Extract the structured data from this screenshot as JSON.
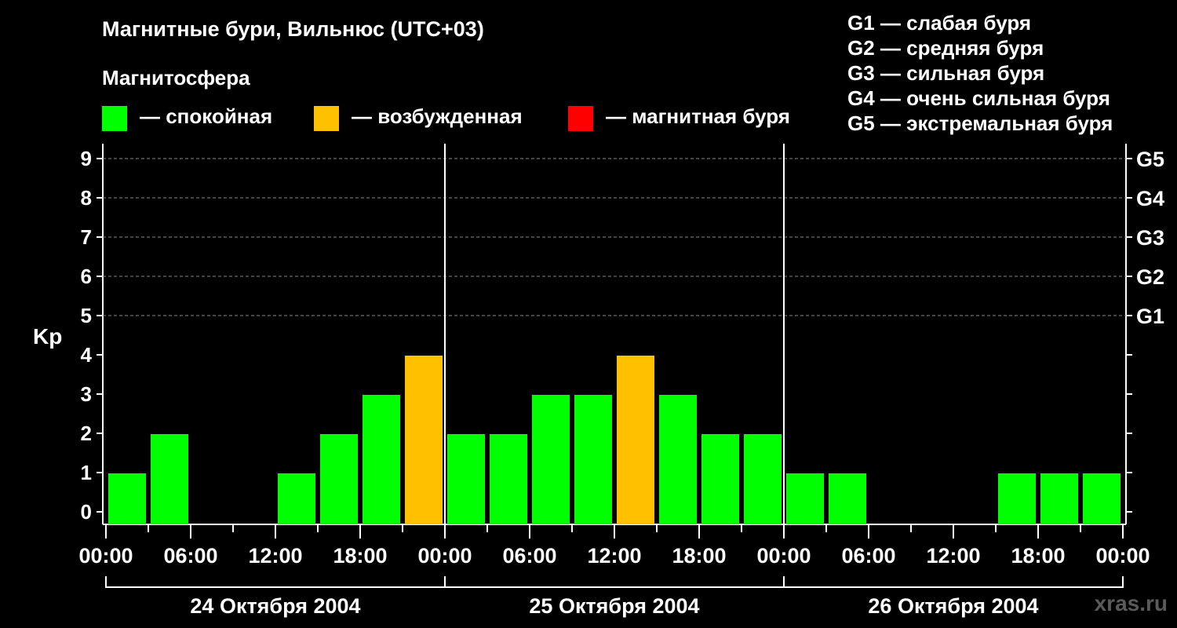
{
  "title": "Магнитные бури, Вильнюс (UTC+03)",
  "magnetosphere_label": "Магнитосфера",
  "legend": [
    {
      "color": "#00ff00",
      "label": "— спокойная"
    },
    {
      "color": "#ffc000",
      "label": "— возбужденная"
    },
    {
      "color": "#ff0000",
      "label": "— магнитная буря"
    }
  ],
  "storm_scale": [
    "G1 — слабая буря",
    "G2 — средняя буря",
    "G3 — сильная буря",
    "G4 — очень сильная буря",
    "G5 — экстремальная буря"
  ],
  "watermark": "xras.ru",
  "chart_data": {
    "type": "bar",
    "ylabel": "Kp",
    "ylim": [
      0,
      9
    ],
    "y_ticks": [
      "0",
      "1",
      "2",
      "3",
      "4",
      "5",
      "6",
      "7",
      "8",
      "9"
    ],
    "right_ticks": [
      {
        "kp": 5,
        "label": "G1"
      },
      {
        "kp": 6,
        "label": "G2"
      },
      {
        "kp": 7,
        "label": "G3"
      },
      {
        "kp": 8,
        "label": "G4"
      },
      {
        "kp": 9,
        "label": "G5"
      }
    ],
    "x_tick_labels": [
      "00:00",
      "06:00",
      "12:00",
      "18:00",
      "00:00",
      "06:00",
      "12:00",
      "18:00",
      "00:00",
      "06:00",
      "12:00",
      "18:00",
      "00:00"
    ],
    "days": [
      "24 Октября 2004",
      "25 Октября 2004",
      "26 Октября 2004"
    ],
    "interval_hours": 3,
    "values": [
      1,
      2,
      0,
      0,
      1,
      2,
      3,
      4,
      2,
      2,
      3,
      3,
      4,
      3,
      2,
      2,
      1,
      1,
      0,
      0,
      0,
      1,
      1,
      1
    ],
    "category_colors": {
      "quiet": "#00ff00",
      "active": "#ffc000",
      "storm": "#ff0000"
    },
    "grid": "dashed at Kp 5-9"
  }
}
